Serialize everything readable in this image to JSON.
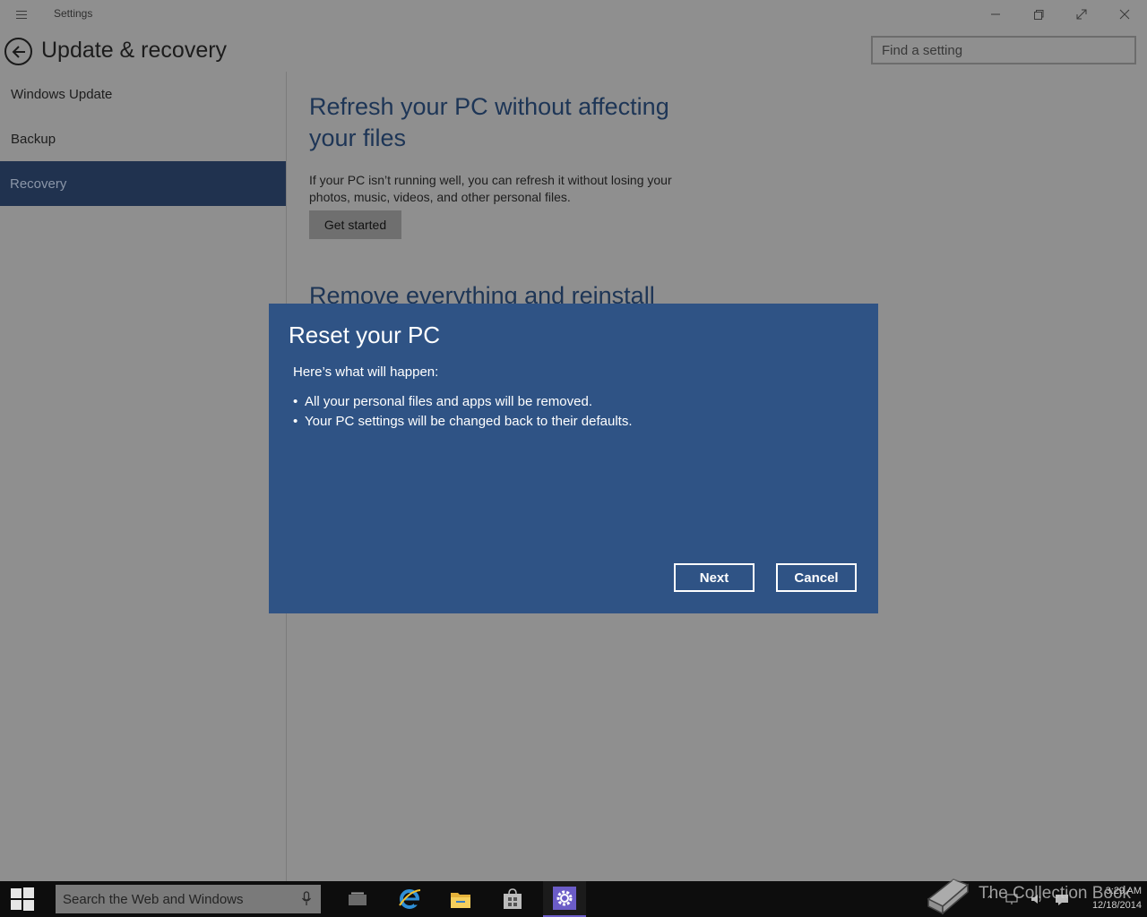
{
  "window": {
    "app_title": "Settings",
    "page_title": "Update & recovery",
    "search_placeholder": "Find a setting"
  },
  "sidebar": {
    "items": [
      {
        "label": "Windows Update"
      },
      {
        "label": "Backup"
      },
      {
        "label": "Recovery",
        "selected": true
      }
    ]
  },
  "main": {
    "refresh": {
      "title": "Refresh your PC without affecting your files",
      "description": "If your PC isn’t running well, you can refresh it without losing your photos, music, videos, and other personal files.",
      "button_label": "Get started"
    },
    "remove": {
      "title": "Remove everything and reinstall"
    }
  },
  "dialog": {
    "title": "Reset your PC",
    "intro": "Here’s what will happen:",
    "items": [
      "All your personal files and apps will be removed.",
      "Your PC settings will be changed back to their defaults."
    ],
    "next_label": "Next",
    "cancel_label": "Cancel"
  },
  "taskbar": {
    "search_placeholder": "Search the Web and Windows",
    "time": "3:29 AM",
    "date": "12/18/2014"
  },
  "watermark": {
    "text": "The Collection Book"
  },
  "colors": {
    "dialog_bg": "#2f5385",
    "sidebar_selected": "#20324f",
    "section_title": "#1d3556",
    "taskbar": "#0d0d0d"
  }
}
